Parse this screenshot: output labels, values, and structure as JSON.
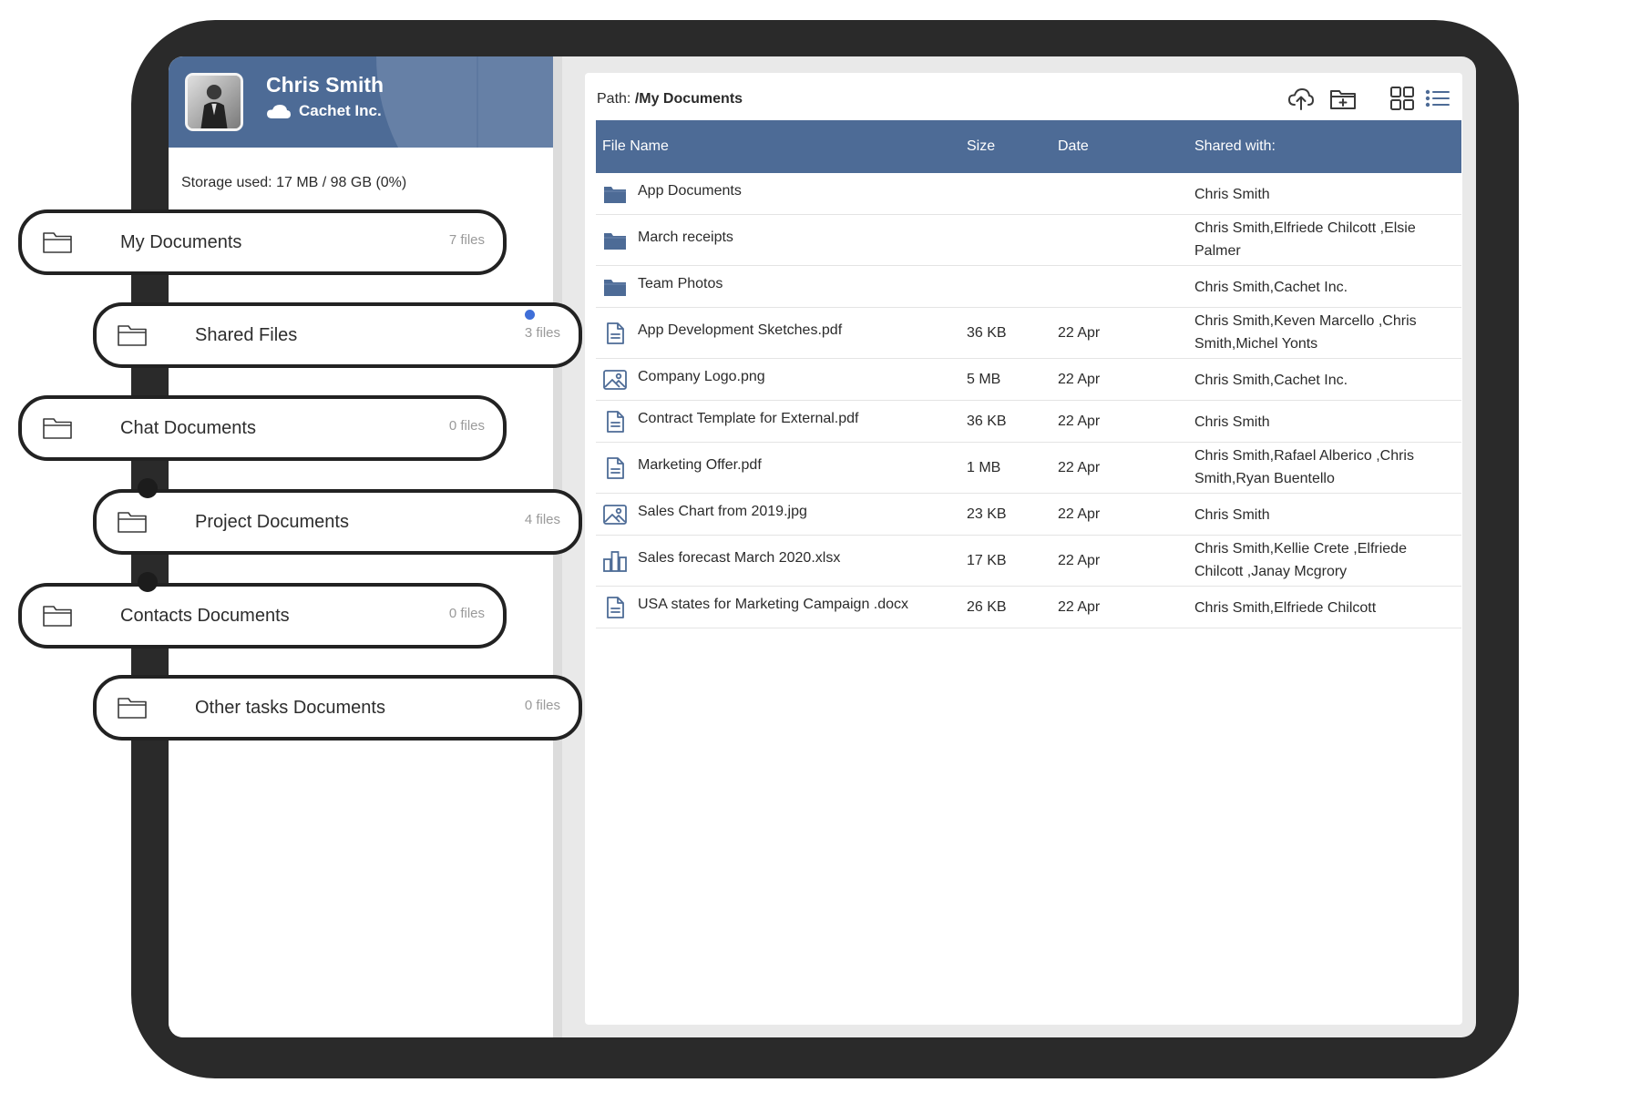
{
  "user": {
    "name": "Chris Smith",
    "company": "Cachet Inc."
  },
  "storage_text": "Storage used: 17 MB / 98 GB (0%)",
  "folders": [
    {
      "name": "My Documents",
      "count": "7 files",
      "icon": "folder-outline-icon"
    },
    {
      "name": "Shared Files",
      "count": "3 files",
      "icon": "folder-outline-icon",
      "notification_dot": true
    },
    {
      "name": "Chat Documents",
      "count": "0 files",
      "icon": "folder-outline-icon"
    },
    {
      "name": "Project Documents",
      "count": "4 files",
      "icon": "folder-outline-icon"
    },
    {
      "name": "Contacts Documents",
      "count": "0 files",
      "icon": "folder-outline-icon"
    },
    {
      "name": "Other tasks Documents",
      "count": "0 files",
      "icon": "folder-outline-icon"
    }
  ],
  "path": {
    "label": "Path:",
    "value": "/My Documents"
  },
  "toolbar_icons": [
    "cloud-upload-icon",
    "new-folder-icon",
    "grid-view-icon",
    "list-view-icon"
  ],
  "table": {
    "columns": [
      "File Name",
      "Size",
      "Date",
      "Shared with:"
    ],
    "rows": [
      {
        "name": "App Documents",
        "size": "",
        "date": "",
        "shared": "Chris Smith",
        "icon": "folder-icon"
      },
      {
        "name": "March receipts",
        "size": "",
        "date": "",
        "shared": "Chris Smith,Elfriede Chilcott ,Elsie Palmer",
        "icon": "folder-icon"
      },
      {
        "name": "Team Photos",
        "size": "",
        "date": "",
        "shared": "Chris Smith,Cachet Inc.",
        "icon": "folder-icon"
      },
      {
        "name": "App Development Sketches.pdf",
        "size": "36 KB",
        "date": "22 Apr",
        "shared": "Chris Smith,Keven Marcello ,Chris Smith,Michel Yonts",
        "icon": "document-icon"
      },
      {
        "name": "Company Logo.png",
        "size": "5 MB",
        "date": "22 Apr",
        "shared": "Chris Smith,Cachet Inc.",
        "icon": "image-icon"
      },
      {
        "name": "Contract Template for External.pdf",
        "size": "36 KB",
        "date": "22 Apr",
        "shared": "Chris Smith",
        "icon": "document-icon"
      },
      {
        "name": "Marketing Offer.pdf",
        "size": "1 MB",
        "date": "22 Apr",
        "shared": "Chris Smith,Rafael Alberico ,Chris Smith,Ryan Buentello",
        "icon": "document-icon"
      },
      {
        "name": "Sales Chart from 2019.jpg",
        "size": "23 KB",
        "date": "22 Apr",
        "shared": "Chris Smith",
        "icon": "image-icon"
      },
      {
        "name": "Sales forecast March 2020.xlsx",
        "size": "17 KB",
        "date": "22 Apr",
        "shared": "Chris Smith,Kellie Crete ,Elfriede Chilcott ,Janay Mcgrory",
        "icon": "bar-chart-icon"
      },
      {
        "name": "USA states for Marketing Campaign .docx",
        "size": "26 KB",
        "date": "22 Apr",
        "shared": "Chris Smith,Elfriede Chilcott",
        "icon": "document-icon"
      }
    ]
  },
  "colors": {
    "accent": "#4d6b96",
    "dot": "#3f6fd8",
    "icon": "#4d6b96"
  }
}
